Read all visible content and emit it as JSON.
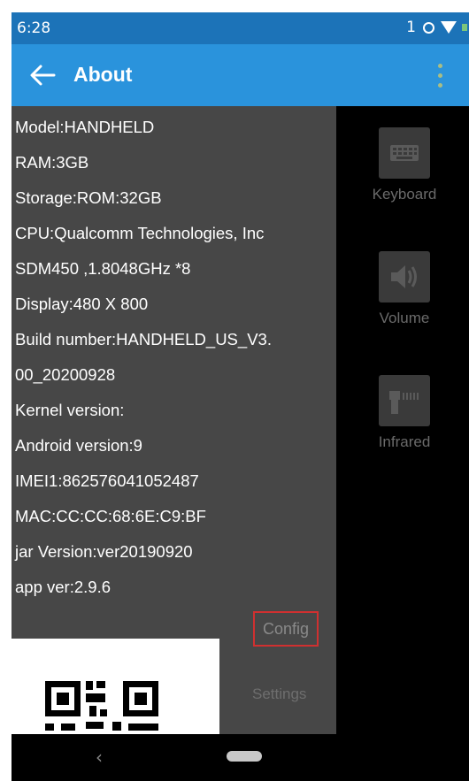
{
  "status_bar": {
    "time": "6:28",
    "indicator": "1",
    "icons": [
      "sync-icon",
      "wifi-icon",
      "battery-icon"
    ]
  },
  "app_bar": {
    "title": "About",
    "back_icon": "arrow-left-icon",
    "menu_icon": "overflow-menu-icon"
  },
  "device_info": {
    "lines": [
      "Model:HANDHELD",
      "RAM:3GB",
      "Storage:ROM:32GB",
      "CPU:Qualcomm Technologies, Inc",
      "SDM450 ,1.8048GHz *8",
      "Display:480 X 800",
      "Build number:HANDHELD_US_V3.",
      "00_20200928",
      "Kernel version:",
      "Android version:9",
      "IMEI1:862576041052487",
      "MAC:CC:CC:68:6E:C9:BF",
      "jar Version:ver20190920",
      "app ver:2.9.6"
    ]
  },
  "actions": {
    "config": "Config",
    "settings": "Settings"
  },
  "side_menu": {
    "items": [
      {
        "label": "Keyboard",
        "icon": "keyboard-icon"
      },
      {
        "label": "Volume",
        "icon": "volume-icon"
      },
      {
        "label": "Infrared",
        "icon": "infrared-scanner-icon"
      }
    ]
  },
  "nav_bar": {
    "back_glyph": "‹",
    "home_icon": "home-pill-icon"
  },
  "colors": {
    "status_bar": "#1c73b8",
    "app_bar": "#2a93dc",
    "panel": "#474747",
    "highlight_border": "#d03030"
  }
}
